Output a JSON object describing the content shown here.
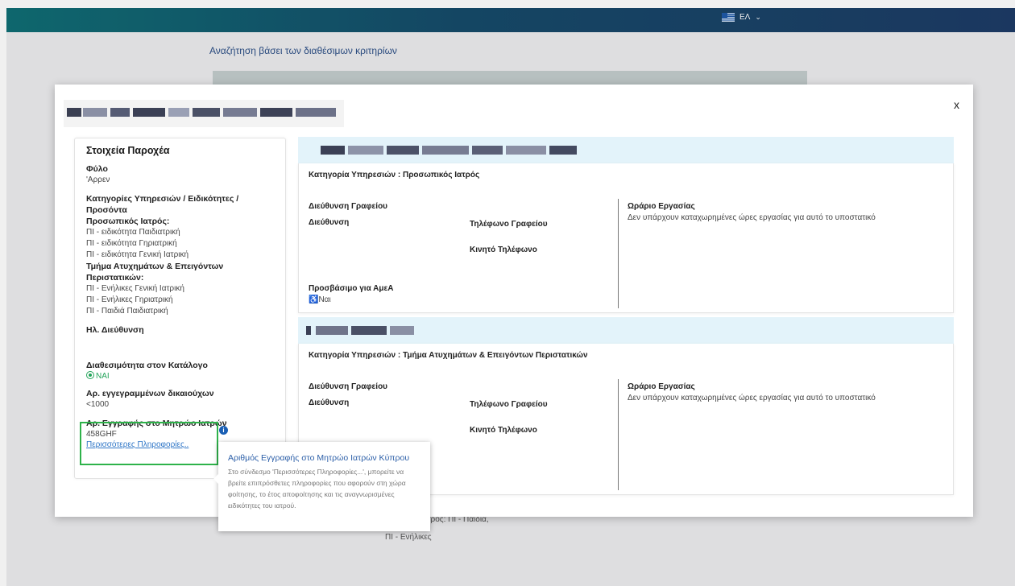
{
  "header": {
    "lang_label": "ΕΛ"
  },
  "background": {
    "search_title": "Αναζήτηση βάσει των διαθέσιμων κριτηρίων",
    "snippet1": "ητρός: ΠΙ - Παιδιά,",
    "snippet2": "ΠΙ - Ενήλικες"
  },
  "modal": {
    "close_label": "x",
    "provider_card": {
      "title": "Στοιχεία Παροχέα",
      "gender_label": "Φύλο",
      "gender_value": "'Αρρεν",
      "categories_label": "Κατηγορίες Υπηρεσιών / Ειδικότητες / Προσόντα",
      "group1_label": "Προσωπικός Ιατρός:",
      "group1_items": [
        "ΠΙ - ειδικότητα Παιδιατρική",
        "ΠΙ - ειδικότητα Γηριατρική",
        "ΠΙ - ειδικότητα Γενική Ιατρική"
      ],
      "group2_label": "Τμήμα Ατυχημάτων & Επειγόντων Περιστατικών:",
      "group2_items": [
        "ΠΙ - Ενήλικες Γενική Ιατρική",
        "ΠΙ - Ενήλικες Γηριατρική",
        "ΠΙ - Παιδιά Παιδιατρική"
      ],
      "email_label": "Ηλ. Διεύθυνση",
      "availability_label": "Διαθεσιμότητα στον Κατάλογο",
      "availability_value": "ΝΑΙ",
      "beneficiaries_label": "Αρ. εγγεγραμμένων δικαιούχων",
      "beneficiaries_value": "<1000",
      "registry_label": "Αρ. Εγγραφής στο Μητρώο Ιατρών",
      "registry_value": "458GHF",
      "more_link": "Περισσότερες Πληροφορίες..",
      "info_icon": "i"
    },
    "sections": [
      {
        "category": "Κατηγορία Υπηρεσιών : Προσωπικός Ιατρός",
        "office_address_label": "Διεύθυνση Γραφείου",
        "address_label": "Διεύθυνση",
        "office_phone_label": "Τηλέφωνο Γραφείου",
        "mobile_label": "Κινητό Τηλέφωνο",
        "accessible_label": "Προσβάσιμο για ΑμεΑ",
        "accessible_icon": "♿",
        "accessible_value": "Ναι",
        "hours_label": "Ωράριο Εργασίας",
        "hours_value": "Δεν υπάρχουν καταχωρημένες ώρες εργασίας για αυτό το υποστατικό"
      },
      {
        "category": "Κατηγορία Υπηρεσιών : Τμήμα Ατυχημάτων & Επειγόντων Περιστατικών",
        "office_address_label": "Διεύθυνση Γραφείου",
        "address_label": "Διεύθυνση",
        "office_phone_label": "Τηλέφωνο Γραφείου",
        "mobile_label": "Κινητό Τηλέφωνο",
        "hours_label": "Ωράριο Εργασίας",
        "hours_value": "Δεν υπάρχουν καταχωρημένες ώρες εργασίας για αυτό το υποστατικό"
      }
    ],
    "tooltip": {
      "title": "Αριθμός Εγγραφής στο Μητρώο Ιατρών Κύπρου",
      "body": "Στο σύνδεσμο 'Περισσότερες Πληροφορίες...', μπορείτε να βρείτε επιπρόσθετες πληροφορίες που αφορούν στη χώρα φοίτησης, το έτος αποφοίτησης και τις αναγνωρισμένες ειδικότητες του ιατρού."
    }
  },
  "colors": {
    "header_start": "#0f6e74",
    "header_end": "#1d3b66",
    "accent_green": "#2eb24a",
    "link_blue": "#2f76c7",
    "section_head": "#e3f3fa"
  }
}
